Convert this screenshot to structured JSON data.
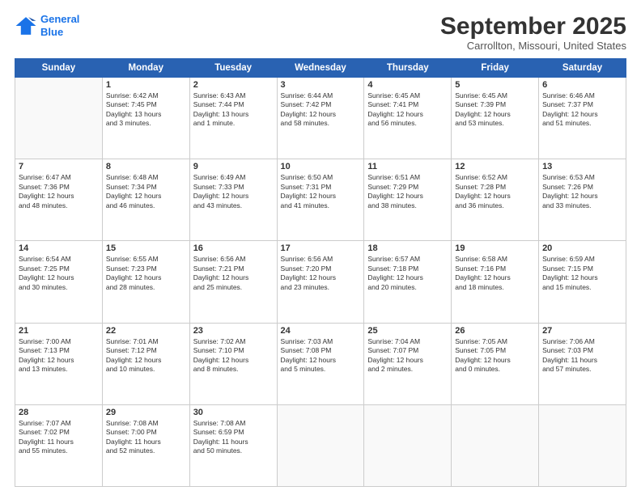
{
  "header": {
    "logo_line1": "General",
    "logo_line2": "Blue",
    "month": "September 2025",
    "location": "Carrollton, Missouri, United States"
  },
  "days_of_week": [
    "Sunday",
    "Monday",
    "Tuesday",
    "Wednesday",
    "Thursday",
    "Friday",
    "Saturday"
  ],
  "weeks": [
    [
      {
        "day": "",
        "info": ""
      },
      {
        "day": "1",
        "info": "Sunrise: 6:42 AM\nSunset: 7:45 PM\nDaylight: 13 hours\nand 3 minutes."
      },
      {
        "day": "2",
        "info": "Sunrise: 6:43 AM\nSunset: 7:44 PM\nDaylight: 13 hours\nand 1 minute."
      },
      {
        "day": "3",
        "info": "Sunrise: 6:44 AM\nSunset: 7:42 PM\nDaylight: 12 hours\nand 58 minutes."
      },
      {
        "day": "4",
        "info": "Sunrise: 6:45 AM\nSunset: 7:41 PM\nDaylight: 12 hours\nand 56 minutes."
      },
      {
        "day": "5",
        "info": "Sunrise: 6:45 AM\nSunset: 7:39 PM\nDaylight: 12 hours\nand 53 minutes."
      },
      {
        "day": "6",
        "info": "Sunrise: 6:46 AM\nSunset: 7:37 PM\nDaylight: 12 hours\nand 51 minutes."
      }
    ],
    [
      {
        "day": "7",
        "info": "Sunrise: 6:47 AM\nSunset: 7:36 PM\nDaylight: 12 hours\nand 48 minutes."
      },
      {
        "day": "8",
        "info": "Sunrise: 6:48 AM\nSunset: 7:34 PM\nDaylight: 12 hours\nand 46 minutes."
      },
      {
        "day": "9",
        "info": "Sunrise: 6:49 AM\nSunset: 7:33 PM\nDaylight: 12 hours\nand 43 minutes."
      },
      {
        "day": "10",
        "info": "Sunrise: 6:50 AM\nSunset: 7:31 PM\nDaylight: 12 hours\nand 41 minutes."
      },
      {
        "day": "11",
        "info": "Sunrise: 6:51 AM\nSunset: 7:29 PM\nDaylight: 12 hours\nand 38 minutes."
      },
      {
        "day": "12",
        "info": "Sunrise: 6:52 AM\nSunset: 7:28 PM\nDaylight: 12 hours\nand 36 minutes."
      },
      {
        "day": "13",
        "info": "Sunrise: 6:53 AM\nSunset: 7:26 PM\nDaylight: 12 hours\nand 33 minutes."
      }
    ],
    [
      {
        "day": "14",
        "info": "Sunrise: 6:54 AM\nSunset: 7:25 PM\nDaylight: 12 hours\nand 30 minutes."
      },
      {
        "day": "15",
        "info": "Sunrise: 6:55 AM\nSunset: 7:23 PM\nDaylight: 12 hours\nand 28 minutes."
      },
      {
        "day": "16",
        "info": "Sunrise: 6:56 AM\nSunset: 7:21 PM\nDaylight: 12 hours\nand 25 minutes."
      },
      {
        "day": "17",
        "info": "Sunrise: 6:56 AM\nSunset: 7:20 PM\nDaylight: 12 hours\nand 23 minutes."
      },
      {
        "day": "18",
        "info": "Sunrise: 6:57 AM\nSunset: 7:18 PM\nDaylight: 12 hours\nand 20 minutes."
      },
      {
        "day": "19",
        "info": "Sunrise: 6:58 AM\nSunset: 7:16 PM\nDaylight: 12 hours\nand 18 minutes."
      },
      {
        "day": "20",
        "info": "Sunrise: 6:59 AM\nSunset: 7:15 PM\nDaylight: 12 hours\nand 15 minutes."
      }
    ],
    [
      {
        "day": "21",
        "info": "Sunrise: 7:00 AM\nSunset: 7:13 PM\nDaylight: 12 hours\nand 13 minutes."
      },
      {
        "day": "22",
        "info": "Sunrise: 7:01 AM\nSunset: 7:12 PM\nDaylight: 12 hours\nand 10 minutes."
      },
      {
        "day": "23",
        "info": "Sunrise: 7:02 AM\nSunset: 7:10 PM\nDaylight: 12 hours\nand 8 minutes."
      },
      {
        "day": "24",
        "info": "Sunrise: 7:03 AM\nSunset: 7:08 PM\nDaylight: 12 hours\nand 5 minutes."
      },
      {
        "day": "25",
        "info": "Sunrise: 7:04 AM\nSunset: 7:07 PM\nDaylight: 12 hours\nand 2 minutes."
      },
      {
        "day": "26",
        "info": "Sunrise: 7:05 AM\nSunset: 7:05 PM\nDaylight: 12 hours\nand 0 minutes."
      },
      {
        "day": "27",
        "info": "Sunrise: 7:06 AM\nSunset: 7:03 PM\nDaylight: 11 hours\nand 57 minutes."
      }
    ],
    [
      {
        "day": "28",
        "info": "Sunrise: 7:07 AM\nSunset: 7:02 PM\nDaylight: 11 hours\nand 55 minutes."
      },
      {
        "day": "29",
        "info": "Sunrise: 7:08 AM\nSunset: 7:00 PM\nDaylight: 11 hours\nand 52 minutes."
      },
      {
        "day": "30",
        "info": "Sunrise: 7:08 AM\nSunset: 6:59 PM\nDaylight: 11 hours\nand 50 minutes."
      },
      {
        "day": "",
        "info": ""
      },
      {
        "day": "",
        "info": ""
      },
      {
        "day": "",
        "info": ""
      },
      {
        "day": "",
        "info": ""
      }
    ]
  ]
}
